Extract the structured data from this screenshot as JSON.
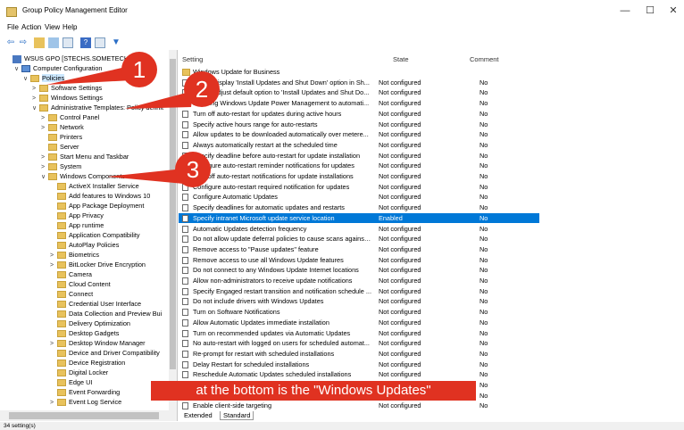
{
  "window": {
    "title": "Group Policy Management Editor",
    "min": "—",
    "max": "☐",
    "close": "✕"
  },
  "menu": [
    "File",
    "Action",
    "View",
    "Help"
  ],
  "toolbar_icons": [
    "back-icon",
    "forward-icon",
    "up-folder-icon",
    "show-hide-tree-icon",
    "export-icon",
    "help-icon",
    "properties-icon",
    "filter-icon"
  ],
  "tree": [
    {
      "label": "WSUS GPO [STECHS.SOMETECH.LO",
      "indent": 0,
      "icon": "gpo"
    },
    {
      "label": "Computer Configuration",
      "indent": 1,
      "chev": "∨",
      "icon": "pc"
    },
    {
      "label": "Policies",
      "indent": 2,
      "chev": "∨",
      "icon": "folder",
      "selected": true
    },
    {
      "label": "Software Settings",
      "indent": 3,
      "chev": ">",
      "icon": "folder"
    },
    {
      "label": "Windows Settings",
      "indent": 3,
      "chev": ">",
      "icon": "folder"
    },
    {
      "label": "Administrative Templates: Policy definit",
      "indent": 3,
      "chev": "∨",
      "icon": "folder"
    },
    {
      "label": "Control Panel",
      "indent": 4,
      "chev": ">",
      "icon": "folder"
    },
    {
      "label": "Network",
      "indent": 4,
      "chev": ">",
      "icon": "folder"
    },
    {
      "label": "Printers",
      "indent": 4,
      "icon": "folder"
    },
    {
      "label": "Server",
      "indent": 4,
      "icon": "folder"
    },
    {
      "label": "Start Menu and Taskbar",
      "indent": 4,
      "chev": ">",
      "icon": "folder"
    },
    {
      "label": "System",
      "indent": 4,
      "chev": ">",
      "icon": "folder"
    },
    {
      "label": "Windows Components",
      "indent": 4,
      "chev": "∨",
      "icon": "folder"
    },
    {
      "label": "ActiveX Installer Service",
      "indent": 5,
      "icon": "folder"
    },
    {
      "label": "Add features to Windows 10",
      "indent": 5,
      "icon": "folder"
    },
    {
      "label": "App Package Deployment",
      "indent": 5,
      "icon": "folder"
    },
    {
      "label": "App Privacy",
      "indent": 5,
      "icon": "folder"
    },
    {
      "label": "App runtime",
      "indent": 5,
      "icon": "folder"
    },
    {
      "label": "Application Compatibility",
      "indent": 5,
      "icon": "folder"
    },
    {
      "label": "AutoPlay Policies",
      "indent": 5,
      "icon": "folder"
    },
    {
      "label": "Biometrics",
      "indent": 5,
      "chev": ">",
      "icon": "folder"
    },
    {
      "label": "BitLocker Drive Encryption",
      "indent": 5,
      "chev": ">",
      "icon": "folder"
    },
    {
      "label": "Camera",
      "indent": 5,
      "icon": "folder"
    },
    {
      "label": "Cloud Content",
      "indent": 5,
      "icon": "folder"
    },
    {
      "label": "Connect",
      "indent": 5,
      "icon": "folder"
    },
    {
      "label": "Credential User Interface",
      "indent": 5,
      "icon": "folder"
    },
    {
      "label": "Data Collection and Preview Bui",
      "indent": 5,
      "icon": "folder"
    },
    {
      "label": "Delivery Optimization",
      "indent": 5,
      "icon": "folder"
    },
    {
      "label": "Desktop Gadgets",
      "indent": 5,
      "icon": "folder"
    },
    {
      "label": "Desktop Window Manager",
      "indent": 5,
      "chev": ">",
      "icon": "folder"
    },
    {
      "label": "Device and Driver Compatibility",
      "indent": 5,
      "icon": "folder"
    },
    {
      "label": "Device Registration",
      "indent": 5,
      "icon": "folder"
    },
    {
      "label": "Digital Locker",
      "indent": 5,
      "icon": "folder"
    },
    {
      "label": "Edge UI",
      "indent": 5,
      "icon": "folder"
    },
    {
      "label": "Event Forwarding",
      "indent": 5,
      "icon": "folder"
    },
    {
      "label": "Event Log Service",
      "indent": 5,
      "chev": ">",
      "icon": "folder"
    }
  ],
  "list": {
    "headers": {
      "setting": "Setting",
      "state": "State",
      "comment": "Comment"
    },
    "rows": [
      {
        "name": "Windows Update for Business",
        "state": "",
        "comment": "",
        "folder": true
      },
      {
        "name": "Do not display 'Install Updates and Shut Down' option in Sh...",
        "state": "Not configured",
        "comment": "No"
      },
      {
        "name": "Do not adjust default option to 'Install Updates and Shut Do...",
        "state": "Not configured",
        "comment": "No"
      },
      {
        "name": "Enabling Windows Update Power Management to automati...",
        "state": "Not configured",
        "comment": "No"
      },
      {
        "name": "Turn off auto-restart for updates during active hours",
        "state": "Not configured",
        "comment": "No"
      },
      {
        "name": "Specify active hours range for auto-restarts",
        "state": "Not configured",
        "comment": "No"
      },
      {
        "name": "Allow updates to be downloaded automatically over metere...",
        "state": "Not configured",
        "comment": "No"
      },
      {
        "name": "Always automatically restart at the scheduled time",
        "state": "Not configured",
        "comment": "No"
      },
      {
        "name": "Specify deadline before auto-restart for update installation",
        "state": "Not configured",
        "comment": "No"
      },
      {
        "name": "Configure auto-restart reminder notifications for updates",
        "state": "Not configured",
        "comment": "No"
      },
      {
        "name": "Turn off auto-restart notifications for update installations",
        "state": "Not configured",
        "comment": "No"
      },
      {
        "name": "Configure auto-restart required notification for updates",
        "state": "Not configured",
        "comment": "No"
      },
      {
        "name": "Configure Automatic Updates",
        "state": "Not configured",
        "comment": "No"
      },
      {
        "name": "Specify deadlines for automatic updates and restarts",
        "state": "Not configured",
        "comment": "No"
      },
      {
        "name": "Specify intranet Microsoft update service location",
        "state": "Enabled",
        "comment": "No",
        "selected": true
      },
      {
        "name": "Automatic Updates detection frequency",
        "state": "Not configured",
        "comment": "No"
      },
      {
        "name": "Do not allow update deferral policies to cause scans against ...",
        "state": "Not configured",
        "comment": "No"
      },
      {
        "name": "Remove access to \"Pause updates\" feature",
        "state": "Not configured",
        "comment": "No"
      },
      {
        "name": "Remove access to use all Windows Update features",
        "state": "Not configured",
        "comment": "No"
      },
      {
        "name": "Do not connect to any Windows Update Internet locations",
        "state": "Not configured",
        "comment": "No"
      },
      {
        "name": "Allow non-administrators to receive update notifications",
        "state": "Not configured",
        "comment": "No"
      },
      {
        "name": "Specify Engaged restart transition and notification schedule ...",
        "state": "Not configured",
        "comment": "No"
      },
      {
        "name": "Do not include drivers with Windows Updates",
        "state": "Not configured",
        "comment": "No"
      },
      {
        "name": "Turn on Software Notifications",
        "state": "Not configured",
        "comment": "No"
      },
      {
        "name": "Allow Automatic Updates immediate installation",
        "state": "Not configured",
        "comment": "No"
      },
      {
        "name": "Turn on recommended updates via Automatic Updates",
        "state": "Not configured",
        "comment": "No"
      },
      {
        "name": "No auto-restart with logged on users for scheduled automat...",
        "state": "Not configured",
        "comment": "No"
      },
      {
        "name": "Re-prompt for restart with scheduled installations",
        "state": "Not configured",
        "comment": "No"
      },
      {
        "name": "Delay Restart for scheduled installations",
        "state": "Not configured",
        "comment": "No"
      },
      {
        "name": "Reschedule Automatic Updates scheduled installations",
        "state": "Not configured",
        "comment": "No"
      },
      {
        "name": "",
        "state": "",
        "comment": "No"
      },
      {
        "name": "",
        "state": "",
        "comment": "No"
      },
      {
        "name": "Enable client-side targeting",
        "state": "Not configured",
        "comment": "No"
      }
    ]
  },
  "tabs": [
    "Extended",
    "Standard"
  ],
  "status": "34 setting(s)",
  "annotations": {
    "badges": [
      "1",
      "2",
      "3"
    ],
    "banner": "at the bottom is the \"Windows Updates\"",
    "color": "#e03221"
  }
}
